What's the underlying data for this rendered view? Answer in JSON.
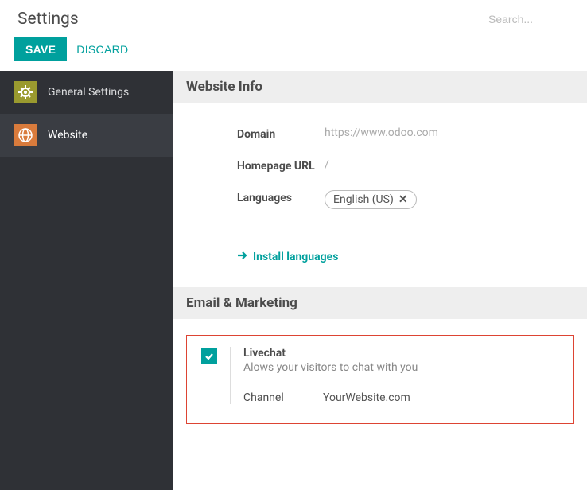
{
  "header": {
    "title": "Settings",
    "search_placeholder": "Search..."
  },
  "toolbar": {
    "save_label": "SAVE",
    "discard_label": "DISCARD"
  },
  "sidebar": {
    "items": [
      {
        "label": "General Settings"
      },
      {
        "label": "Website"
      }
    ]
  },
  "sections": {
    "website_info": {
      "title": "Website Info",
      "fields": {
        "domain_label": "Domain",
        "domain_value": "https://www.odoo.com",
        "homepage_label": "Homepage URL",
        "homepage_value": "/",
        "languages_label": "Languages",
        "language_tag": "English (US)",
        "install_link": "Install languages"
      }
    },
    "marketing": {
      "title": "Email & Marketing",
      "livechat": {
        "title": "Livechat",
        "desc": "Alows your visitors to chat with you",
        "channel_label": "Channel",
        "channel_value": "YourWebsite.com"
      }
    }
  }
}
